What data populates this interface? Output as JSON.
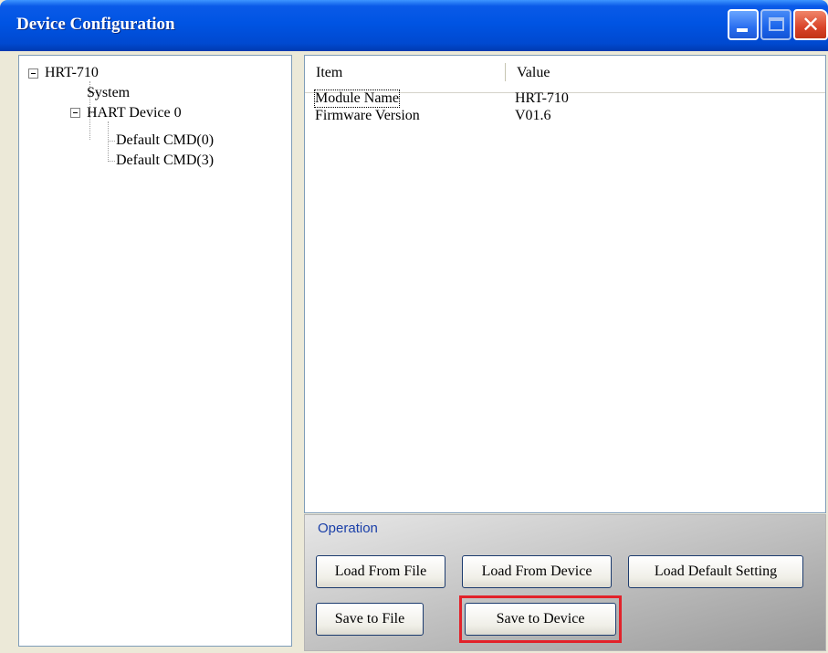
{
  "window": {
    "title": "Device Configuration"
  },
  "tree": {
    "root": "HRT-710",
    "system": "System",
    "device": "HART Device 0",
    "cmd0": "Default CMD(0)",
    "cmd3": "Default CMD(3)"
  },
  "list": {
    "columns": [
      "Item",
      "Value"
    ],
    "rows": [
      {
        "item": "Module Name",
        "value": "HRT-710"
      },
      {
        "item": "Firmware Version",
        "value": "V01.6"
      }
    ]
  },
  "operation": {
    "label": "Operation",
    "load_from_file": "Load From File",
    "load_from_device": "Load From Device",
    "load_default": "Load Default Setting",
    "save_to_file": "Save to File",
    "save_to_device": "Save to Device"
  },
  "colors": {
    "titlebar": "#0054e3",
    "highlight": "#e2222a",
    "operation_label": "#1a3fa8"
  }
}
